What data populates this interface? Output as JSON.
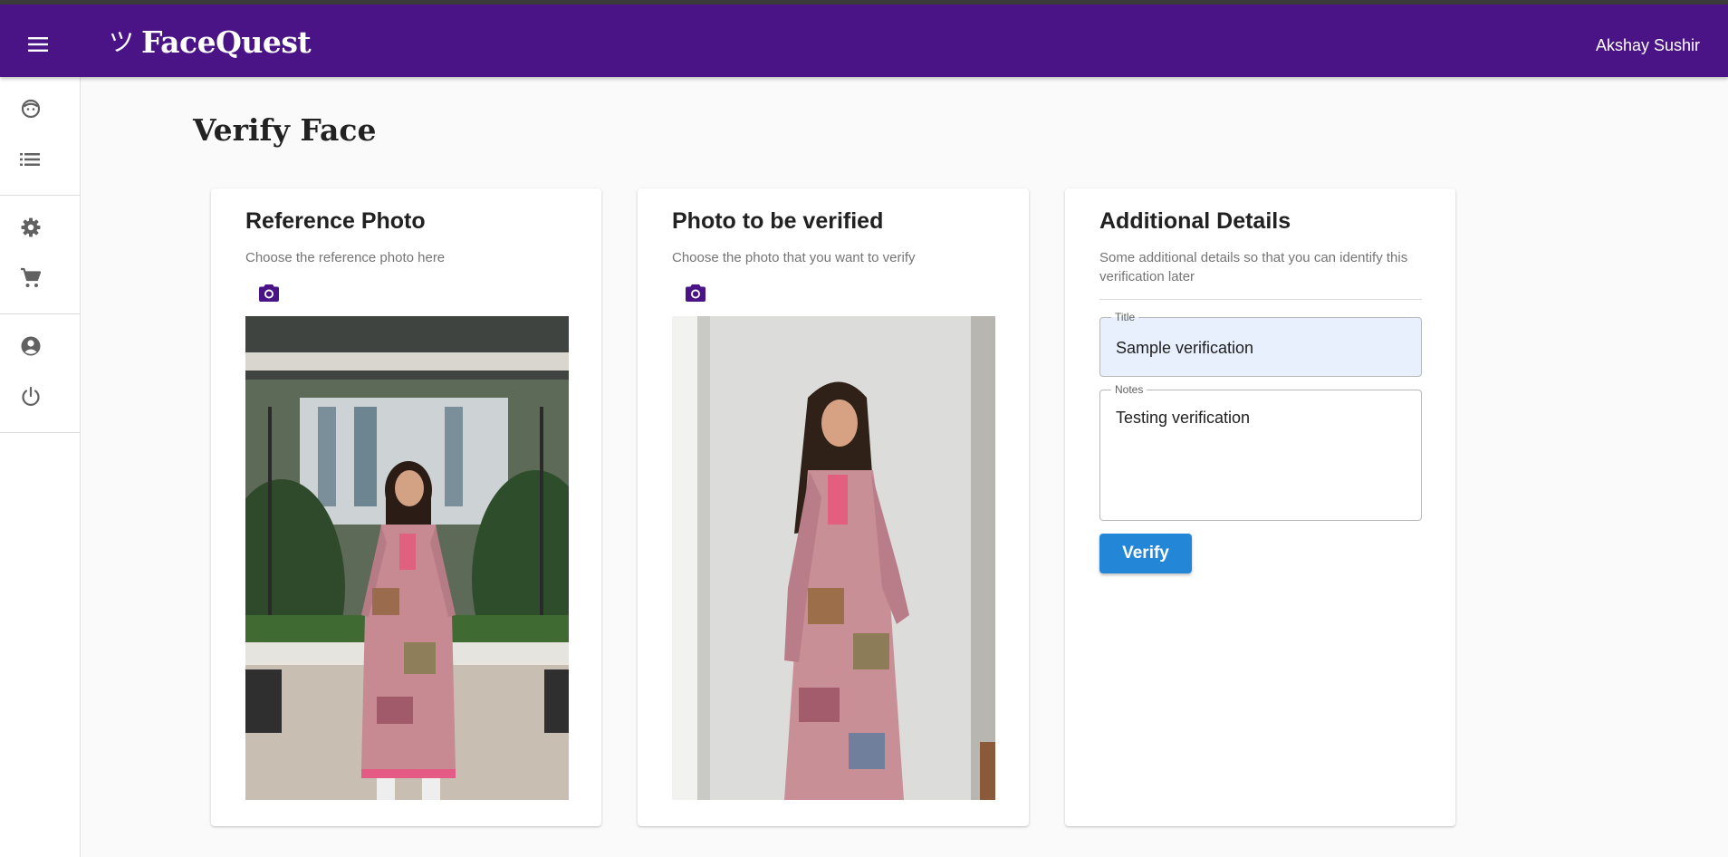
{
  "app": {
    "brand_logo": "ツ",
    "brand_name": "FaceQuest",
    "user_name": "Akshay Sushir",
    "accent_color": "#4a1486",
    "primary_button_color": "#2386d6"
  },
  "sidebar": {
    "groups": [
      [
        {
          "icon": "face-icon"
        },
        {
          "icon": "list-icon"
        }
      ],
      [
        {
          "icon": "settings-icon"
        },
        {
          "icon": "cart-icon"
        }
      ],
      [
        {
          "icon": "account-icon"
        },
        {
          "icon": "power-icon"
        }
      ]
    ]
  },
  "page": {
    "title": "Verify Face"
  },
  "reference_card": {
    "title": "Reference Photo",
    "subtitle": "Choose the reference photo here",
    "camera_icon": "camera-icon"
  },
  "verify_card": {
    "title": "Photo to be verified",
    "subtitle": "Choose the photo that you want to verify",
    "camera_icon": "camera-icon"
  },
  "details_card": {
    "title": "Additional Details",
    "subtitle": "Some additional details so that you can identify this verification later",
    "title_field": {
      "label": "Title",
      "value": "Sample verification"
    },
    "notes_field": {
      "label": "Notes",
      "value": "Testing verification"
    },
    "verify_label": "Verify"
  }
}
